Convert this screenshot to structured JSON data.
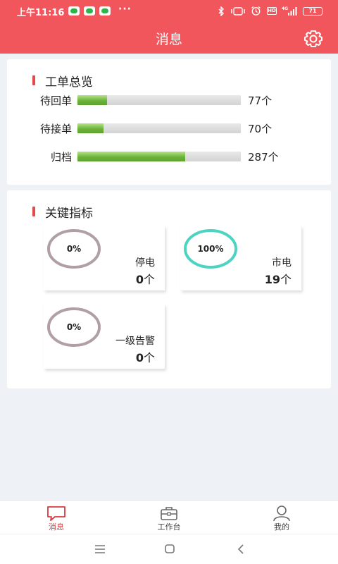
{
  "status_bar": {
    "time": "上午11:16",
    "dots": "···",
    "network": "4G",
    "hd": "HD",
    "battery": "71",
    "icons": [
      "wechat-icon",
      "wechat-icon",
      "wechat-icon",
      "bluetooth-icon",
      "vibrate-icon",
      "alarm-icon",
      "hd-icon",
      "signal-icon",
      "battery-icon"
    ]
  },
  "header": {
    "title": "消息",
    "settings_icon": "gear-icon",
    "bg_color": "#f0565b"
  },
  "work_orders": {
    "title": "工单总览",
    "rows": [
      {
        "label": "待回单",
        "count": "77个",
        "progress": 0.18
      },
      {
        "label": "待接单",
        "count": "70个",
        "progress": 0.16
      },
      {
        "label": "归档",
        "count": "287个",
        "progress": 0.66
      }
    ]
  },
  "key_metrics": {
    "title": "关键指标",
    "items": [
      {
        "percent": "0%",
        "label": "停电",
        "value": "0",
        "unit": "个",
        "ring_color": "#b09fa3"
      },
      {
        "percent": "100%",
        "label": "市电",
        "value": "19",
        "unit": "个",
        "ring_color": "#4dd3c2"
      },
      {
        "percent": "0%",
        "label": "一级告警",
        "value": "0",
        "unit": "个",
        "ring_color": "#b09fa3"
      }
    ]
  },
  "tabs": [
    {
      "label": "消息",
      "icon": "message-icon",
      "active": true
    },
    {
      "label": "工作台",
      "icon": "briefcase-icon",
      "active": false
    },
    {
      "label": "我的",
      "icon": "user-icon",
      "active": false
    }
  ],
  "nav": [
    "menu-icon",
    "home-icon",
    "back-icon"
  ],
  "colors": {
    "accent": "#f0565b",
    "progress": "#6db33a",
    "active_tab": "#d9393f"
  }
}
